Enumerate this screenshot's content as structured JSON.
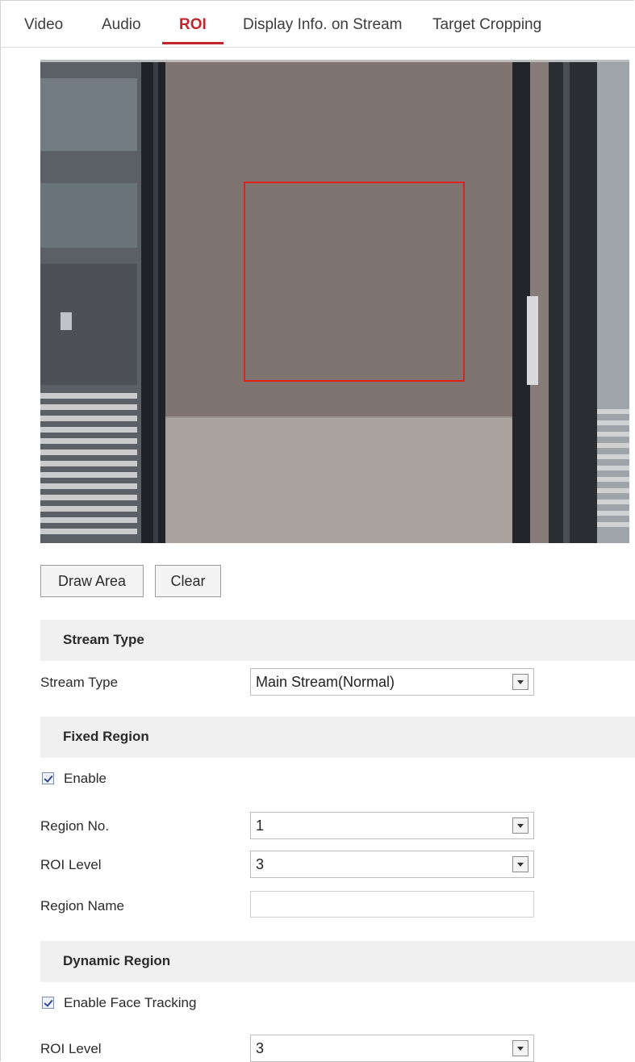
{
  "tabs": [
    "Video",
    "Audio",
    "ROI",
    "Display Info. on Stream",
    "Target Cropping"
  ],
  "active_tab": "ROI",
  "buttons": {
    "draw_area": "Draw Area",
    "clear": "Clear"
  },
  "stream_type_section": {
    "header": "Stream Type",
    "label": "Stream Type",
    "value": "Main Stream(Normal)"
  },
  "fixed_region": {
    "header": "Fixed Region",
    "enable_label": "Enable",
    "enabled": true,
    "region_no_label": "Region No.",
    "region_no_value": "1",
    "roi_level_label": "ROI Level",
    "roi_level_value": "3",
    "region_name_label": "Region Name",
    "region_name_value": ""
  },
  "dynamic_region": {
    "header": "Dynamic Region",
    "face_tracking_label": "Enable Face Tracking",
    "face_tracking_enabled": true,
    "roi_level_label": "ROI Level",
    "roi_level_value": "3"
  },
  "colors": {
    "accent": "#c0272d",
    "roi_box": "#e02020",
    "section_bg": "#f0f0f0"
  }
}
